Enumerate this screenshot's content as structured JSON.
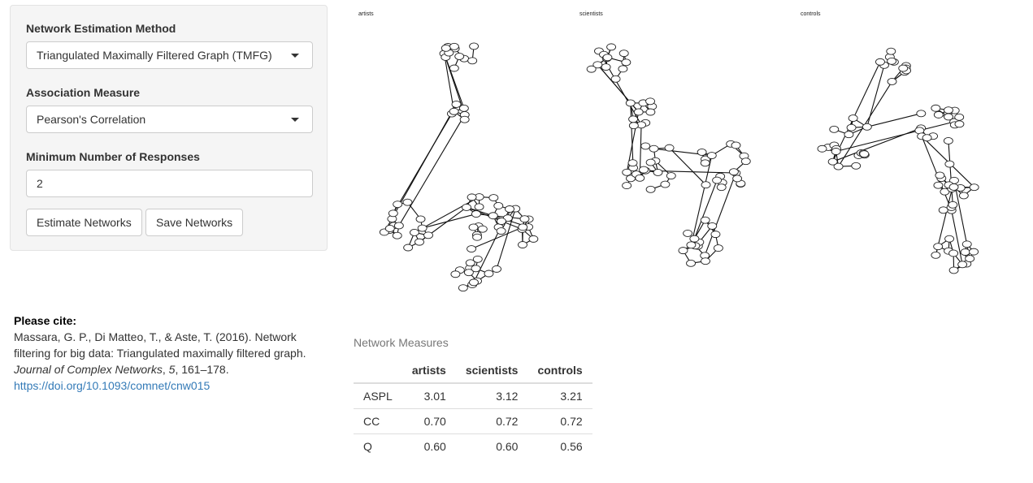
{
  "controls": {
    "method": {
      "label": "Network Estimation Method",
      "value": "Triangulated Maximally Filtered Graph (TMFG)"
    },
    "association": {
      "label": "Association Measure",
      "value": "Pearson's Correlation"
    },
    "min_responses": {
      "label": "Minimum Number of Responses",
      "value": "2"
    },
    "estimate_label": "Estimate Networks",
    "save_label": "Save Networks"
  },
  "citation": {
    "heading": "Please cite:",
    "authors": "Massara, G. P., Di Matteo, T., & Aste, T. (2016). Network filtering for big data: Triangulated maximally filtered graph.",
    "journal": "Journal of Complex Networks",
    "volume": "5",
    "pages": ", 161–178.",
    "doi": "https://doi.org/10.1093/comnet/cnw015"
  },
  "plots": [
    {
      "title": "artists"
    },
    {
      "title": "scientists"
    },
    {
      "title": "controls"
    }
  ],
  "measures": {
    "caption": "Network Measures",
    "columns": [
      "",
      "artists",
      "scientists",
      "controls"
    ],
    "rows": [
      {
        "name": "ASPL",
        "values": [
          "3.01",
          "3.12",
          "3.21"
        ]
      },
      {
        "name": "CC",
        "values": [
          "0.70",
          "0.72",
          "0.72"
        ]
      },
      {
        "name": "Q",
        "values": [
          "0.60",
          "0.60",
          "0.56"
        ]
      }
    ]
  }
}
